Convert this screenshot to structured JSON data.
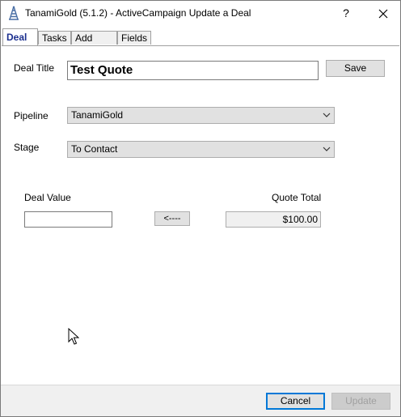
{
  "window": {
    "title": "TanamiGold (5.1.2) - ActiveCampaign Update a Deal",
    "help_label": "?",
    "close_label": "✕",
    "app_icon": "tower-icon"
  },
  "tabs": [
    {
      "label": "Deal",
      "active": true
    },
    {
      "label": "Tasks",
      "active": false
    },
    {
      "label": "Add Note",
      "active": false
    },
    {
      "label": "Fields",
      "active": false
    }
  ],
  "deal": {
    "title_label": "Deal Title",
    "title_value": "Test Quote",
    "save_label": "Save",
    "pipeline_label": "Pipeline",
    "pipeline_value": "TanamiGold",
    "stage_label": "Stage",
    "stage_value": "To Contact",
    "deal_value_label": "Deal Value",
    "deal_value": "",
    "transfer_label": "<----",
    "quote_total_label": "Quote Total",
    "quote_total_value": "$100.00"
  },
  "footer": {
    "cancel_label": "Cancel",
    "update_label": "Update",
    "update_enabled": false
  },
  "colors": {
    "active_tab_text": "#1b2f8f",
    "focus_border": "#0078d7"
  }
}
